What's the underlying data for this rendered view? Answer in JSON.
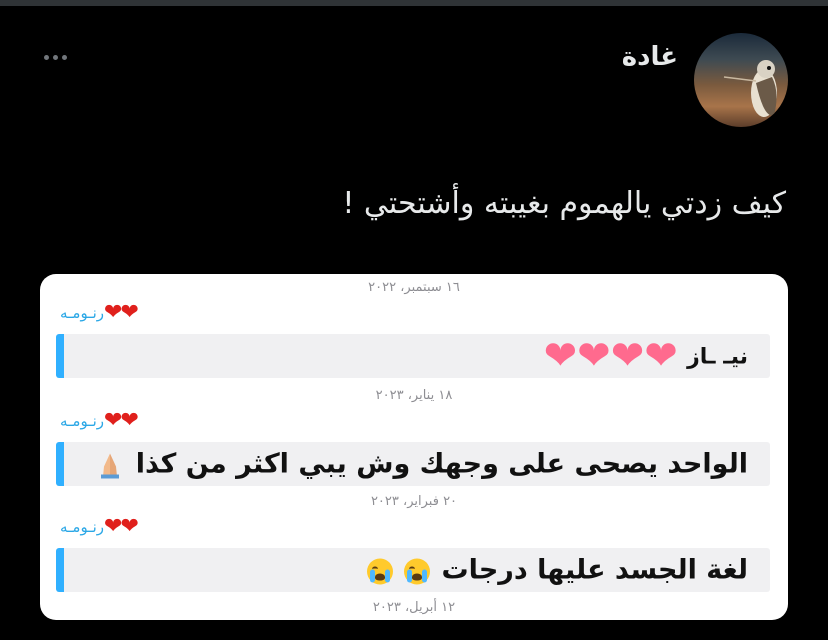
{
  "tweet": {
    "author_name": "غادة",
    "text": "كيف زدتي يالهموم بغيبته وأشتحتي !",
    "more_icon": "more-horizontal-icon"
  },
  "chat": {
    "dates": [
      "١٦ سبتمبر، ٢٠٢٢",
      "١٨ يناير، ٢٠٢٣",
      "٢٠ فبراير، ٢٠٢٣",
      "١٢ أبريل، ٢٠٢٣"
    ],
    "messages": [
      {
        "sender": "رنـومـه",
        "sender_hearts": "❤❤",
        "text": "نيـ ـاز",
        "icon": "hearts-icon"
      },
      {
        "sender": "رنـومـه",
        "sender_hearts": "❤❤",
        "text": "الواحد يصحى على وجهك وش يبي اكثر من كذا",
        "icon": "praying-hands-icon"
      },
      {
        "sender": "رنـومـه",
        "sender_hearts": "❤❤",
        "text": "لغة الجسد عليها درجات",
        "icon": "crying-face-icon"
      }
    ]
  },
  "colors": {
    "sender_name": "#2aa7e6",
    "bubble_bar": "#30b0ff",
    "heart": "#e0201c",
    "big_heart": "#ff6a8e"
  }
}
